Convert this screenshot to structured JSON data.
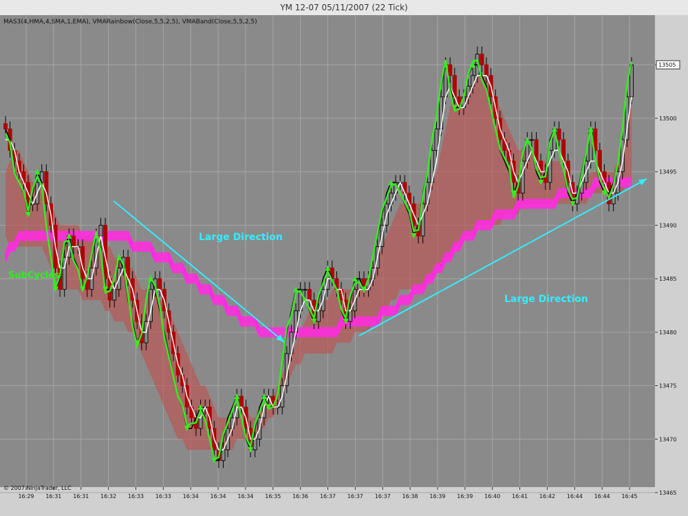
{
  "window": {
    "title": "YM 12-07  05/11/2007  (22 Tick)",
    "indicator_line": "MAS3(4,HMA,4,SMA,1,EMA), VMARainbow(Close,5,5,2,5), VMABand(Close,5,5,2,5)",
    "copyright": "© 2007 NinjaTrader, LLC",
    "price_badge": "13505"
  },
  "colors": {
    "plot_bg": "#8a8a8a",
    "grid": "#a6a6a6",
    "band": "#c0504d",
    "rainbow": "#ff2ddf",
    "bull": "#101010",
    "bear": "#b00000",
    "hma": "#000000",
    "sma": "#ffffff",
    "ema": "#34ee20",
    "annot_cyan": "#33eeff",
    "annot_green": "#30f020"
  },
  "annotations": {
    "large_direction_1": "Large Direction",
    "large_direction_2": "Large Direction",
    "subcycles": "SubCycles"
  },
  "chart_data": {
    "type": "candlestick",
    "title": "YM 12-07  05/11/2007  (22 Tick)",
    "y_axis": {
      "ticks": [
        13465,
        13470,
        13475,
        13480,
        13485,
        13490,
        13495,
        13500,
        13505
      ],
      "ylim": [
        13465,
        13509
      ],
      "position": "right"
    },
    "x_axis": {
      "tick_labels": [
        "16:29",
        "16:31",
        "16:31",
        "16:32",
        "16:33",
        "16:33",
        "16:34",
        "16:34",
        "16:34",
        "16:35",
        "16:36",
        "16:37",
        "16:37",
        "16:37",
        "16:38",
        "16:39",
        "16:39",
        "16:40",
        "16:41",
        "16:42",
        "16:44",
        "16:44",
        "16:45"
      ]
    },
    "grid": true,
    "close": [
      13499,
      13497,
      13496,
      13495,
      13494,
      13492,
      13492,
      13494,
      13495,
      13492,
      13490,
      13486,
      13484,
      13487,
      13489,
      13488,
      13488,
      13485,
      13484,
      13486,
      13489,
      13490,
      13485,
      13483,
      13484,
      13486,
      13487,
      13485,
      13483,
      13481,
      13479,
      13481,
      13484,
      13485,
      13484,
      13482,
      13480,
      13478,
      13476,
      13475,
      13473,
      13472,
      13471,
      13473,
      13473,
      13471,
      13469,
      13468,
      13469,
      13471,
      13472,
      13474,
      13473,
      13471,
      13469,
      13470,
      13472,
      13474,
      13474,
      13473,
      13473,
      13475,
      13478,
      13480,
      13482,
      13484,
      13484,
      13483,
      13481,
      13482,
      13484,
      13486,
      13485,
      13484,
      13483,
      13481,
      13482,
      13484,
      13485,
      13484,
      13485,
      13486,
      13488,
      13490,
      13492,
      13493,
      13494,
      13494,
      13493,
      13492,
      13490,
      13489,
      13492,
      13494,
      13497,
      13499,
      13502,
      13505,
      13504,
      13502,
      13501,
      13502,
      13503,
      13504,
      13506,
      13505,
      13504,
      13502,
      13500,
      13498,
      13497,
      13496,
      13494,
      13493,
      13496,
      13498,
      13498,
      13496,
      13495,
      13494,
      13497,
      13499,
      13498,
      13496,
      13494,
      13492,
      13493,
      13494,
      13496,
      13499,
      13497,
      13495,
      13494,
      13492,
      13493,
      13495,
      13498,
      13502,
      13505
    ],
    "hma_line": [
      13499,
      13498,
      13495,
      13494,
      13493,
      13491,
      13493,
      13495,
      13494,
      13490,
      13487,
      13484,
      13485,
      13488,
      13489,
      13487,
      13486,
      13484,
      13485,
      13487,
      13489,
      13488,
      13484,
      13484,
      13485,
      13487,
      13486,
      13483,
      13481,
      13479,
      13480,
      13483,
      13485,
      13484,
      13482,
      13480,
      13478,
      13476,
      13474,
      13473,
      13471,
      13471,
      13472,
      13473,
      13472,
      13470,
      13468,
      13468,
      13470,
      13472,
      13473,
      13474,
      13472,
      13470,
      13469,
      13471,
      13473,
      13474,
      13473,
      13473,
      13474,
      13477,
      13480,
      13482,
      13484,
      13484,
      13483,
      13482,
      13481,
      13483,
      13485,
      13486,
      13485,
      13484,
      13482,
      13481,
      13483,
      13485,
      13485,
      13484,
      13485,
      13487,
      13489,
      13491,
      13493,
      13494,
      13494,
      13493,
      13492,
      13491,
      13489,
      13490,
      13493,
      13495,
      13498,
      13500,
      13503,
      13505,
      13503,
      13501,
      13501,
      13502,
      13504,
      13505,
      13505,
      13504,
      13503,
      13501,
      13499,
      13497,
      13496,
      13495,
      13493,
      13494,
      13497,
      13498,
      13497,
      13495,
      13494,
      13495,
      13498,
      13499,
      13497,
      13495,
      13493,
      13492,
      13493,
      13495,
      13497,
      13499,
      13496,
      13494,
      13493,
      13493,
      13494,
      13496,
      13499,
      13503,
      13505
    ],
    "sma_line": [
      13498,
      13498,
      13497,
      13495,
      13494,
      13493,
      13492,
      13493,
      13494,
      13493,
      13491,
      13488,
      13486,
      13486,
      13488,
      13488,
      13488,
      13486,
      13485,
      13485,
      13487,
      13489,
      13487,
      13485,
      13484,
      13485,
      13486,
      13485,
      13484,
      13482,
      13480,
      13480,
      13482,
      13484,
      13484,
      13483,
      13481,
      13479,
      13477,
      13476,
      13474,
      13473,
      13472,
      13472,
      13473,
      13472,
      13470,
      13469,
      13469,
      13470,
      13471,
      13473,
      13473,
      13472,
      13470,
      13470,
      13471,
      13473,
      13474,
      13473,
      13473,
      13474,
      13476,
      13478,
      13480,
      13482,
      13483,
      13483,
      13482,
      13482,
      13483,
      13485,
      13485,
      13484,
      13484,
      13482,
      13482,
      13483,
      13484,
      13484,
      13484,
      13485,
      13487,
      13489,
      13491,
      13492,
      13493,
      13494,
      13493,
      13492,
      13491,
      13490,
      13491,
      13492,
      13494,
      13496,
      13499,
      13502,
      13503,
      13502,
      13501,
      13501,
      13502,
      13503,
      13504,
      13504,
      13504,
      13503,
      13501,
      13499,
      13498,
      13497,
      13495,
      13494,
      13495,
      13496,
      13497,
      13496,
      13495,
      13495,
      13496,
      13497,
      13497,
      13496,
      13495,
      13493,
      13493,
      13494,
      13495,
      13496,
      13496,
      13495,
      13494,
      13493,
      13493,
      13494,
      13496,
      13499,
      13502
    ],
    "band_upper": [
      13495,
      13496,
      13497,
      13497,
      13496,
      13495,
      13494,
      13494,
      13494,
      13493,
      13492,
      13491,
      13490,
      13490,
      13490,
      13490,
      13490,
      13489,
      13489,
      13489,
      13489,
      13489,
      13488,
      13488,
      13487,
      13487,
      13487,
      13486,
      13486,
      13485,
      13484,
      13484,
      13484,
      13484,
      13483,
      13483,
      13482,
      13481,
      13480,
      13479,
      13478,
      13477,
      13476,
      13475,
      13475,
      13474,
      13473,
      13472,
      13472,
      13472,
      13472,
      13472,
      13473,
      13473,
      13472,
      13472,
      13473,
      13474,
      13474,
      13474,
      13475,
      13476,
      13477,
      13478,
      13479,
      13480,
      13481,
      13482,
      13482,
      13482,
      13483,
      13483,
      13484,
      13484,
      13484,
      13484,
      13484,
      13484,
      13485,
      13485,
      13485,
      13486,
      13487,
      13488,
      13489,
      13490,
      13491,
      13492,
      13492,
      13492,
      13492,
      13492,
      13492,
      13493,
      13494,
      13495,
      13497,
      13499,
      13501,
      13502,
      13502,
      13502,
      13503,
      13503,
      13504,
      13504,
      13504,
      13503,
      13502,
      13501,
      13500,
      13499,
      13498,
      13497,
      13497,
      13497,
      13497,
      13496,
      13496,
      13496,
      13496,
      13496,
      13496,
      13495,
      13494,
      13493,
      13493,
      13494,
      13494,
      13495,
      13495,
      13495,
      13495,
      13495,
      13495,
      13496,
      13497,
      13499,
      13502
    ],
    "band_lower": [
      13489,
      13488,
      13488,
      13488,
      13488,
      13488,
      13488,
      13488,
      13488,
      13487,
      13486,
      13485,
      13484,
      13484,
      13484,
      13484,
      13484,
      13483,
      13483,
      13483,
      13483,
      13483,
      13482,
      13482,
      13481,
      13481,
      13481,
      13480,
      13480,
      13479,
      13478,
      13477,
      13476,
      13475,
      13474,
      13473,
      13472,
      13471,
      13470,
      13470,
      13469,
      13469,
      13469,
      13469,
      13469,
      13469,
      13469,
      13469,
      13469,
      13469,
      13469,
      13470,
      13470,
      13470,
      13470,
      13470,
      13471,
      13471,
      13472,
      13472,
      13473,
      13474,
      13475,
      13476,
      13477,
      13477,
      13478,
      13478,
      13478,
      13478,
      13478,
      13478,
      13478,
      13479,
      13479,
      13479,
      13479,
      13480,
      13480,
      13480,
      13480,
      13481,
      13481,
      13482,
      13482,
      13483,
      13483,
      13484,
      13484,
      13484,
      13484,
      13484,
      13484,
      13485,
      13485,
      13486,
      13486,
      13487,
      13487,
      13488,
      13488,
      13489,
      13489,
      13489,
      13490,
      13490,
      13490,
      13490,
      13490,
      13490,
      13491,
      13491,
      13491,
      13491,
      13492,
      13492,
      13492,
      13492,
      13492,
      13492,
      13492,
      13492,
      13492,
      13492,
      13492,
      13492,
      13492,
      13492,
      13492,
      13493,
      13493,
      13493,
      13493,
      13493,
      13493,
      13493,
      13493,
      13494,
      13494
    ],
    "rainbow_center": [
      13487,
      13488,
      13488,
      13489,
      13489,
      13489,
      13489,
      13489,
      13489,
      13489,
      13489,
      13489,
      13489,
      13489,
      13489,
      13489,
      13489,
      13489,
      13489,
      13489,
      13489,
      13489,
      13489,
      13489,
      13489,
      13489,
      13489,
      13489,
      13488,
      13488,
      13488,
      13488,
      13488,
      13487,
      13487,
      13487,
      13487,
      13486,
      13486,
      13486,
      13485,
      13485,
      13485,
      13484,
      13484,
      13484,
      13483,
      13483,
      13483,
      13482,
      13482,
      13482,
      13481,
      13481,
      13481,
      13481,
      13480,
      13480,
      13480,
      13480,
      13480,
      13480,
      13480,
      13480,
      13480,
      13480,
      13480,
      13480,
      13480,
      13480,
      13480,
      13480,
      13480,
      13480,
      13481,
      13481,
      13481,
      13481,
      13481,
      13481,
      13481,
      13481,
      13481,
      13482,
      13482,
      13482,
      13482,
      13483,
      13483,
      13483,
      13484,
      13484,
      13484,
      13485,
      13485,
      13486,
      13486,
      13487,
      13487,
      13488,
      13488,
      13489,
      13489,
      13489,
      13490,
      13490,
      13490,
      13490,
      13491,
      13491,
      13491,
      13491,
      13491,
      13492,
      13492,
      13492,
      13492,
      13492,
      13492,
      13492,
      13492,
      13492,
      13493,
      13493,
      13493,
      13493,
      13493,
      13493,
      13493,
      13493,
      13494,
      13494,
      13494,
      13494,
      13494,
      13494,
      13494,
      13494,
      13494
    ]
  }
}
